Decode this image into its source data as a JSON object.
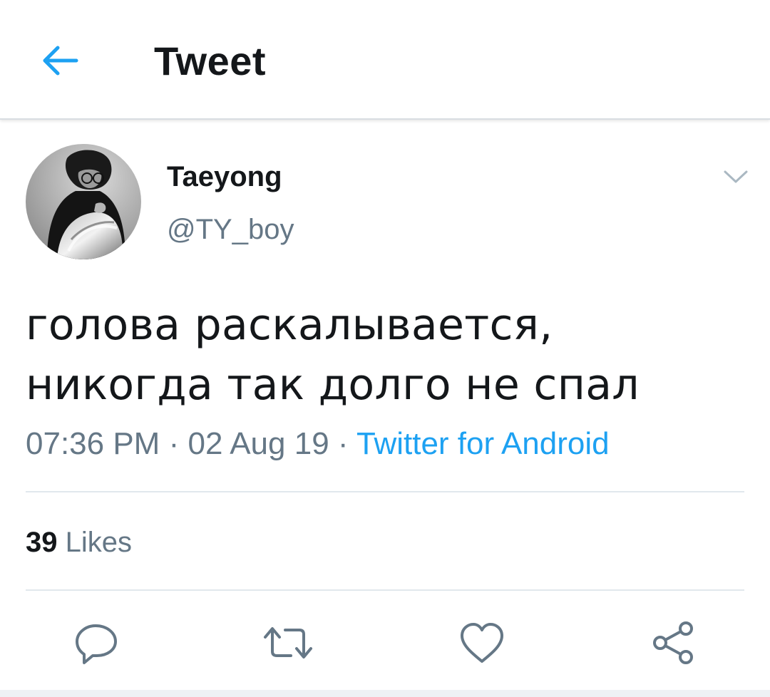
{
  "header": {
    "title": "Tweet",
    "back_icon": "arrow-left-icon",
    "accent_color": "#1da1f2"
  },
  "tweet": {
    "author": {
      "name": "Taeyong",
      "handle": "@TY_boy",
      "avatar_icon": "profile-photo"
    },
    "text": "голова раскалывается, никогда так долго не спал",
    "time": "07:36 PM",
    "separator": "·",
    "date": "02 Aug 19",
    "source": "Twitter for Android",
    "likes": {
      "count": "39",
      "label": "Likes"
    }
  },
  "actions": {
    "reply_icon": "reply-icon",
    "retweet_icon": "retweet-icon",
    "like_icon": "heart-icon",
    "share_icon": "share-icon"
  },
  "colors": {
    "text_primary": "#14171a",
    "text_secondary": "#657786",
    "link": "#1da1f2",
    "divider": "#e1e8ed"
  }
}
